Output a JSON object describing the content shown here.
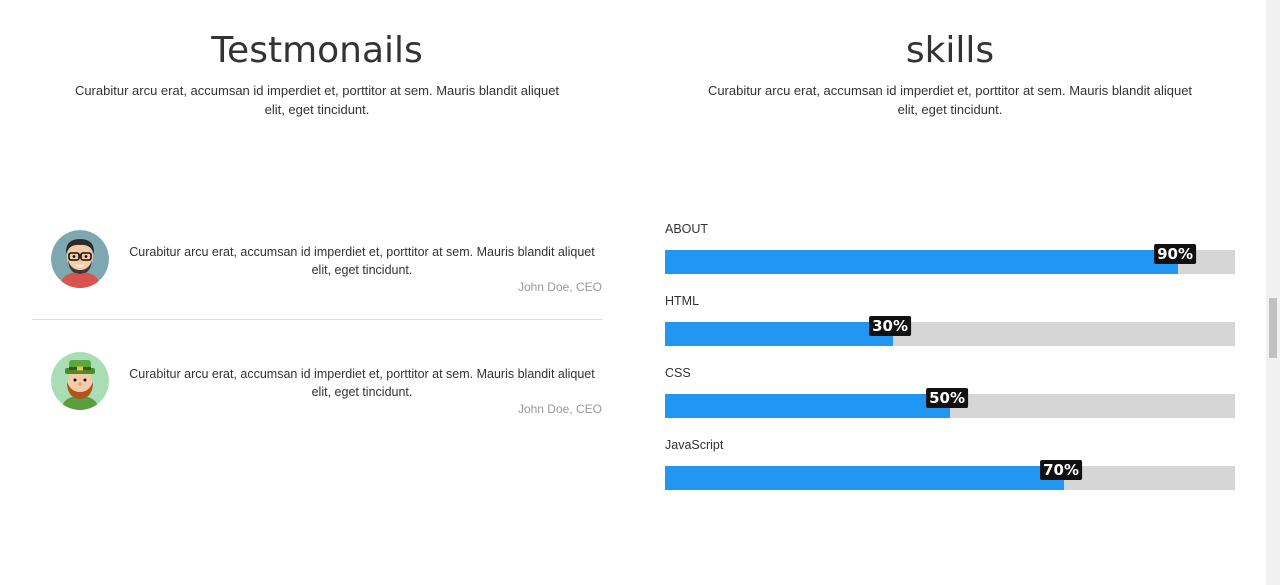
{
  "testimonials": {
    "title": "Testmonails",
    "description": "Curabitur arcu erat, accumsan id imperdiet et, porttitor at sem. Mauris blandit aliquet elit, eget tincidunt.",
    "items": [
      {
        "text": "Curabitur arcu erat, accumsan id imperdiet et, porttitor at sem. Mauris blandit aliquet elit, eget tincidunt.",
        "author": "John Doe, CEO",
        "avatar_icon": "man-with-glasses-avatar"
      },
      {
        "text": "Curabitur arcu erat, accumsan id imperdiet et, porttitor at sem. Mauris blandit aliquet elit, eget tincidunt.",
        "author": "John Doe, CEO",
        "avatar_icon": "leprechaun-avatar"
      }
    ]
  },
  "skills": {
    "title": "skills",
    "description": "Curabitur arcu erat, accumsan id imperdiet et, porttitor at sem. Mauris blandit aliquet elit, eget tincidunt.",
    "items": [
      {
        "label": "ABOUT",
        "percent": 90,
        "percent_label": "90%"
      },
      {
        "label": "HTML",
        "percent": 40,
        "percent_label": "30%"
      },
      {
        "label": "CSS",
        "percent": 50,
        "percent_label": "50%"
      },
      {
        "label": "JavaScript",
        "percent": 70,
        "percent_label": "70%"
      }
    ],
    "bar_color": "#2196f3",
    "track_color": "#d6d6d6",
    "badge_color": "#111111"
  }
}
